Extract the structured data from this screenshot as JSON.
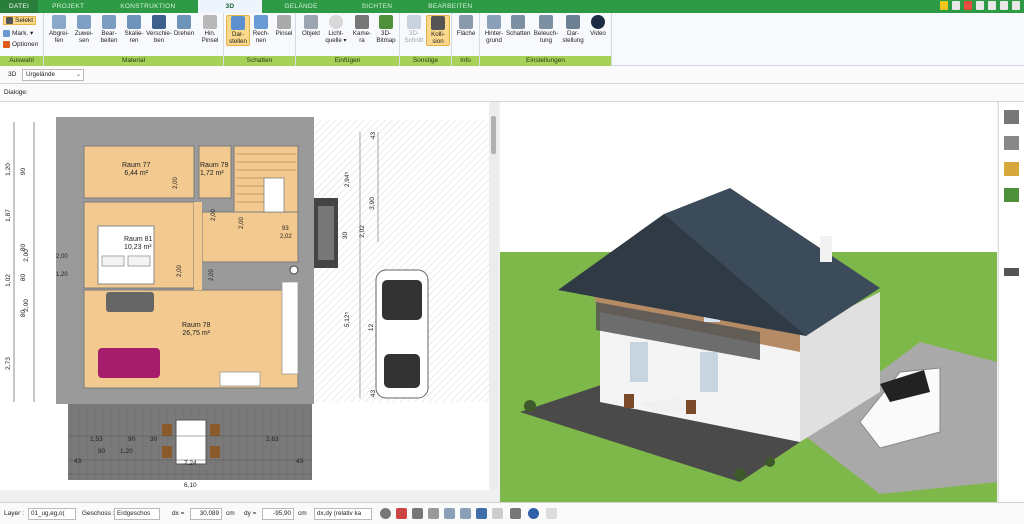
{
  "tabs": [
    "DATEI",
    "PROJEKT",
    "KONSTRUKTION",
    "3D",
    "GELÄNDE",
    "SICHTEN",
    "BEARBEITEN"
  ],
  "active_tab": "3D",
  "ribbon": {
    "auswahl": {
      "select": "Selekt",
      "mark": "Mark. ▾",
      "optionen": "Optionen",
      "label": "Auswahl"
    },
    "material": {
      "label": "Material",
      "buttons": [
        "Abgrei-\nfen",
        "Zuwei-\nsen",
        "Bear-\nbeiten",
        "Skalie-\nren",
        "Verschie-\nben",
        "Drehen",
        "Hin.\nPinsel"
      ]
    },
    "schatten": {
      "label": "Schatten",
      "buttons": [
        "Dar-\nstellen",
        "Rech-\nnen",
        "Pinsel"
      ]
    },
    "einfuegen": {
      "label": "Einfügen",
      "buttons": [
        "Objekt",
        "Licht-\nquelle ▾",
        "Kame-\nra",
        "3D-\nBitmap"
      ]
    },
    "sonstige": {
      "label": "Sonstige",
      "buttons": [
        "3D-\nSchnitt",
        "Kolli-\nsion"
      ]
    },
    "info": {
      "label": "Info",
      "buttons": [
        "Fläche"
      ]
    },
    "einstellungen": {
      "label": "Einstellungen",
      "buttons": [
        "Hinter-\ngrund",
        "Schatten",
        "Beleuch-\ntung",
        "Dar-\nstellung",
        "Video"
      ]
    }
  },
  "toolbar2": {
    "mode": "3D",
    "terrain": "Urgelände"
  },
  "toolbar3": {
    "label": "Dialoge:"
  },
  "plan": {
    "rooms": [
      {
        "name": "Raum 77",
        "area": "6,44 m²"
      },
      {
        "name": "Raum 79",
        "area": "1,72 m²"
      },
      {
        "name": "Raum 81",
        "area": "10,23 m²"
      },
      {
        "name": "Raum 78",
        "area": "26,75 m²"
      }
    ],
    "dims_left": [
      "1,20",
      "1,87",
      "2,00",
      "1,02",
      "2,00",
      "2,73",
      "90",
      "80",
      "80",
      "80"
    ],
    "dims_right": [
      "2,94⁵",
      "3,90",
      "2,02",
      "5,12⁵",
      "30",
      "43",
      "43",
      "12"
    ],
    "dims_bottom": [
      "1,53",
      "90",
      "30",
      "1,20",
      "80",
      "2,63",
      "7,24",
      "6,10",
      "43",
      "43"
    ],
    "small_labels": [
      "2,00",
      "2,00",
      "2,00",
      "2,00",
      "93",
      "2,02",
      "2,00",
      "1,20",
      "2,00"
    ]
  },
  "status": {
    "layer_label": "Layer :",
    "layer_value": "01_ug,eg,o(",
    "geschoss_label": "Geschoss :",
    "geschoss_value": "Erdgeschos",
    "dx_label": "dx =",
    "dx_value": "30,089",
    "dx_unit": "cm",
    "dy_label": "dy =",
    "dy_value": "-95,90",
    "dy_unit": "cm",
    "mode_value": "dx,dy (relativ ka"
  },
  "colors": {
    "accent_green": "#2e9a46",
    "ribbon_group": "#a8d15a",
    "floor_wood": "#f2c98f",
    "wall": "#7f7f7f",
    "sky": "#ffffff",
    "grass": "#7eb84a"
  }
}
